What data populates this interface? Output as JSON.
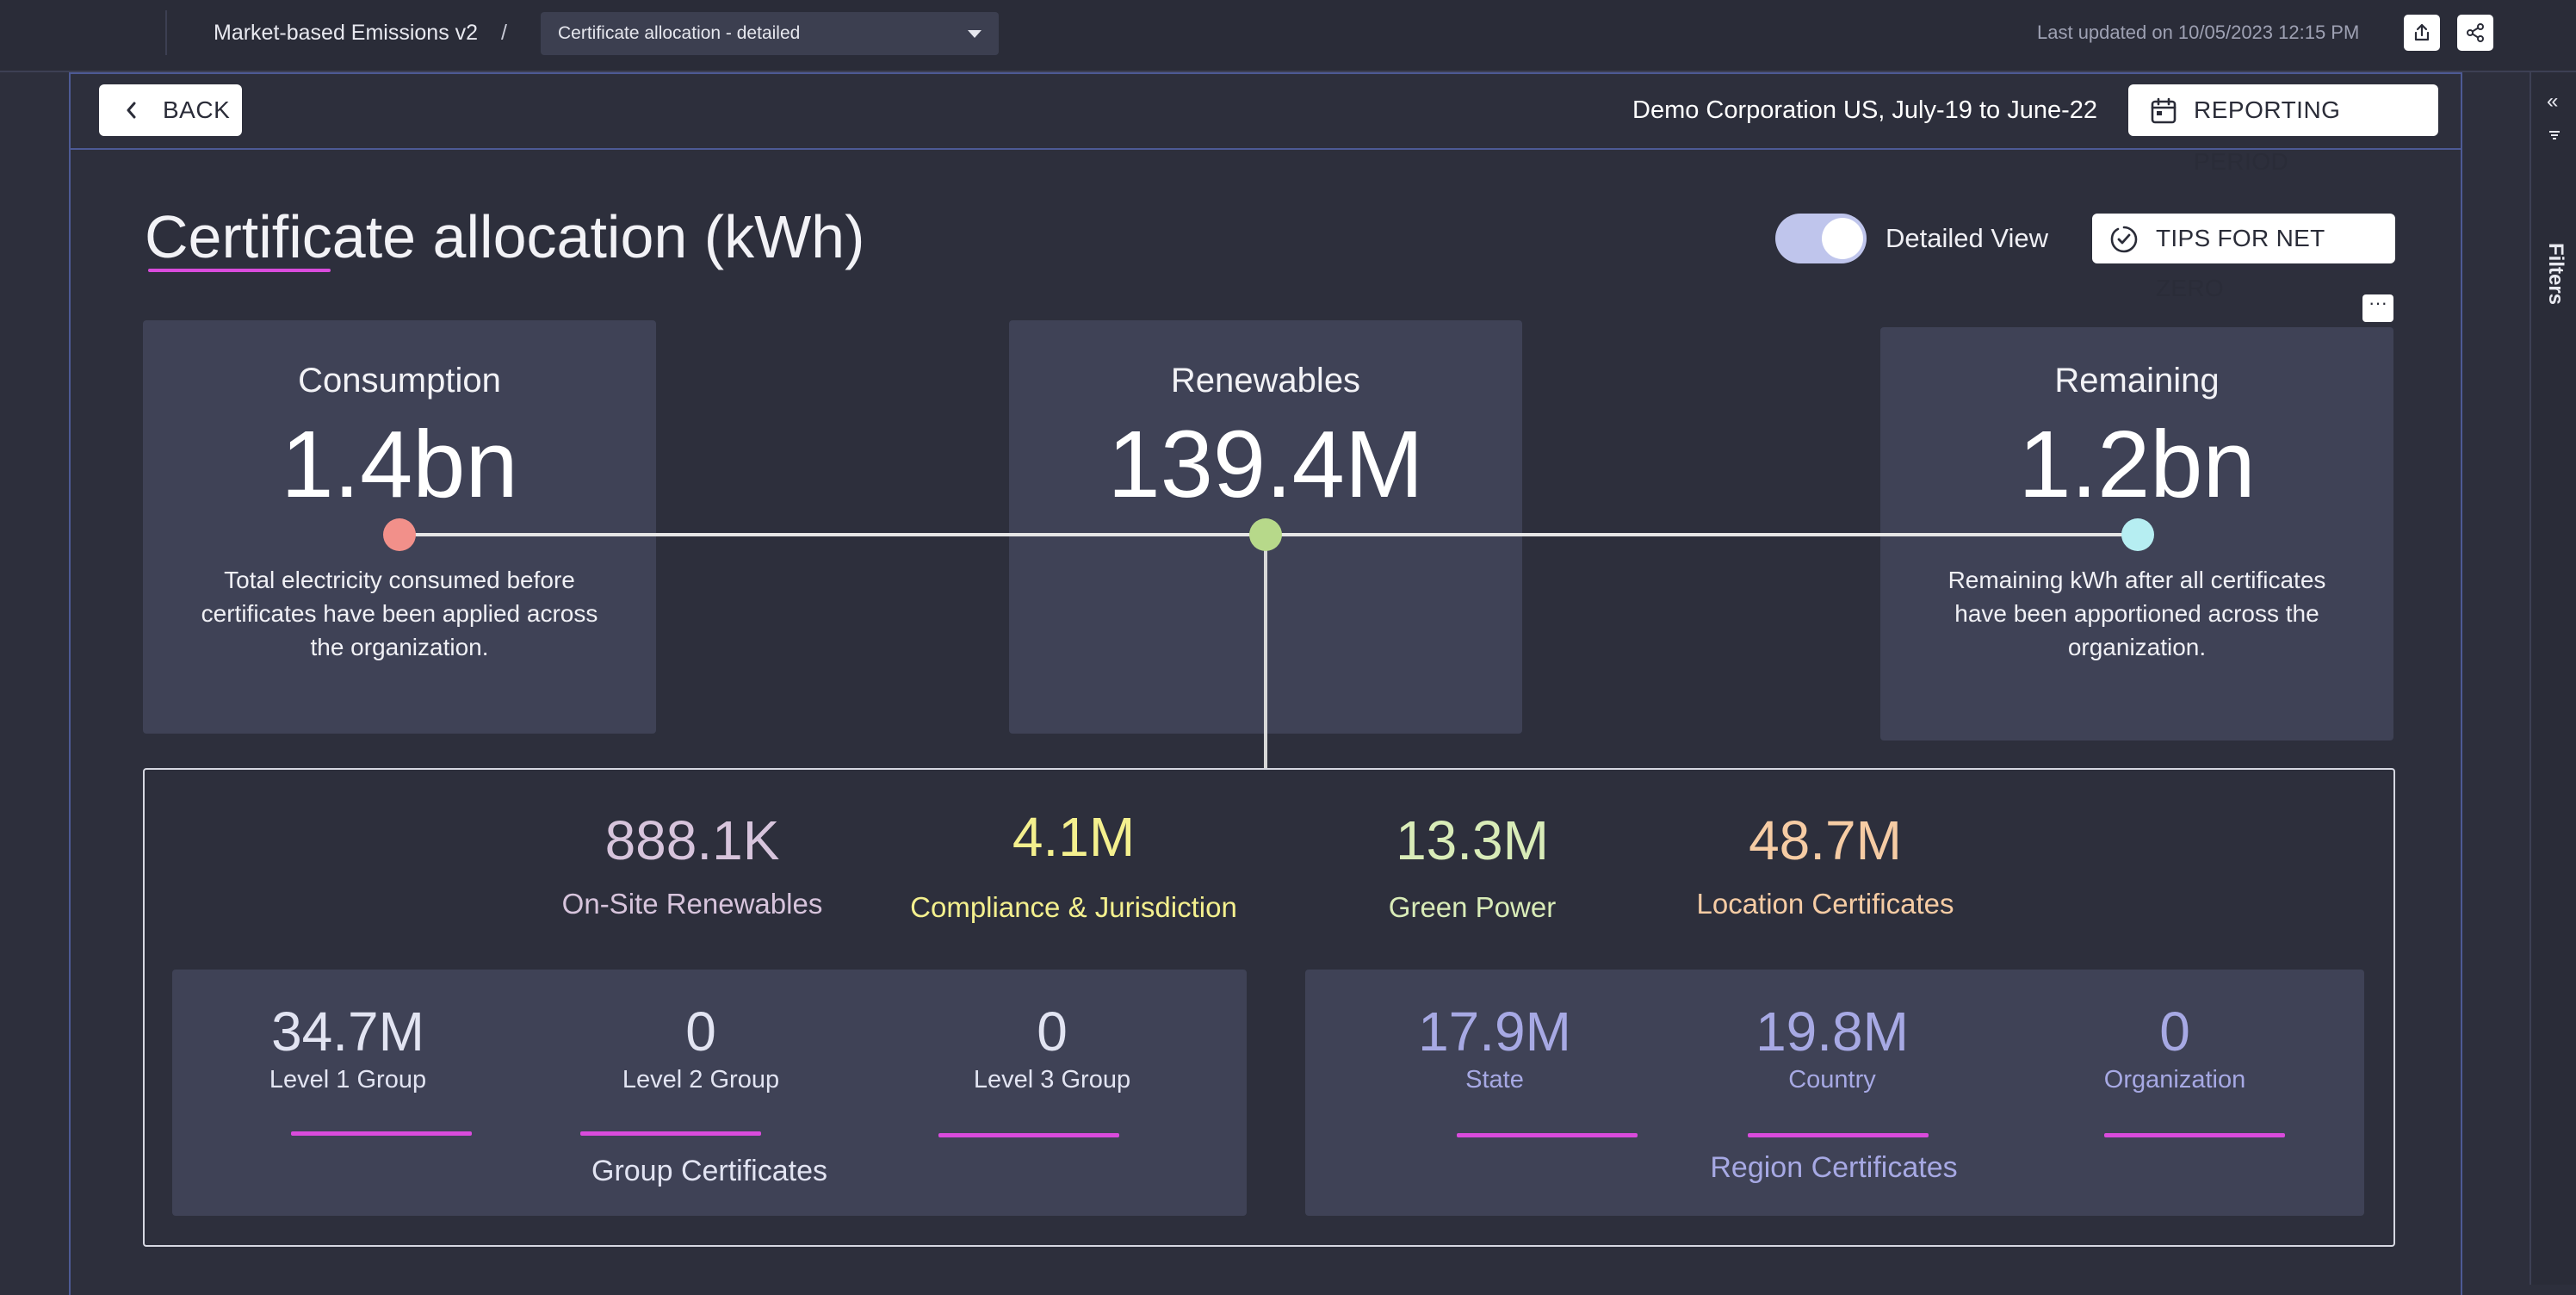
{
  "topbar": {
    "dashboard_title": "Market-based Emissions v2",
    "separator": "/",
    "page_selector": "Certificate allocation - detailed",
    "last_updated": "Last updated on 10/05/2023 12:15 PM",
    "export_icon": "export-icon",
    "share_icon": "share-icon"
  },
  "rail": {
    "collapse_symbol": "«",
    "filters_label": "Filters"
  },
  "header": {
    "back_label": "BACK",
    "org_range": "Demo Corporation US, July-19 to June-22",
    "reporting_period_label": "REPORTING PERIOD"
  },
  "title": {
    "text": "Certificate allocation (kWh)",
    "detailed_view_label": "Detailed View",
    "detailed_view_on": true,
    "tips_label": "TIPS FOR NET ZERO",
    "more_label": "···"
  },
  "cards": [
    {
      "title": "Consumption",
      "value": "1.4bn",
      "desc_lines": [
        "Total electricity consumed before",
        "certificates have been applied across",
        "the organization."
      ],
      "dot_color": "#f2908a"
    },
    {
      "title": "Renewables",
      "value": "139.4M",
      "dot_color": "#b7d98a"
    },
    {
      "title": "Remaining",
      "value": "1.2bn",
      "desc_lines": [
        "Remaining kWh after all certificates",
        "have been apportioned across the",
        "organization."
      ],
      "dot_color": "#b6eef2"
    }
  ],
  "breakdown": [
    {
      "value": "888.1K",
      "label": "On-Site Renewables",
      "color": "#d7c4dc"
    },
    {
      "value": "4.1M",
      "label": "Compliance & Jurisdiction",
      "color": "#f4f08e"
    },
    {
      "value": "13.3M",
      "label": "Green Power",
      "color": "#d9ecb8"
    },
    {
      "value": "48.7M",
      "label": "Location Certificates",
      "color": "#f6cca4"
    }
  ],
  "group_certificates": {
    "caption": "Group Certificates",
    "items": [
      {
        "value": "34.7M",
        "label": "Level 1 Group"
      },
      {
        "value": "0",
        "label": "Level 2 Group"
      },
      {
        "value": "0",
        "label": "Level 3 Group"
      }
    ],
    "color": "#e2e4f2"
  },
  "region_certificates": {
    "caption": "Region Certificates",
    "items": [
      {
        "value": "17.9M",
        "label": "State"
      },
      {
        "value": "19.8M",
        "label": "Country"
      },
      {
        "value": "0",
        "label": "Organization"
      }
    ],
    "color": "#a7a9e4"
  },
  "colors": {
    "accent_underline": "#d94bdc",
    "frame_border": "#4d5a95",
    "card_bg": "#3f4256",
    "page_bg": "#2d2f3c"
  }
}
